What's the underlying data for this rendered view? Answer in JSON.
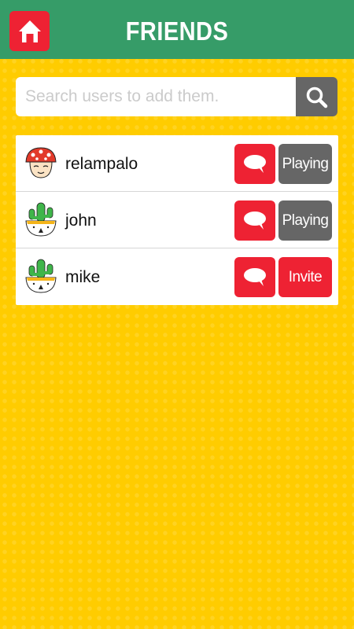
{
  "header": {
    "title": "FRIENDS",
    "home_icon": "home-icon",
    "background_color": "#369c68"
  },
  "search": {
    "placeholder": "Search users to add them.",
    "value": "",
    "button_icon": "search-icon"
  },
  "friends": [
    {
      "name": "relampalo",
      "avatar": "mushroom-avatar",
      "status": "Playing",
      "chat_icon": "chat-bubble-icon"
    },
    {
      "name": "john",
      "avatar": "cactus-avatar",
      "status": "Playing",
      "chat_icon": "chat-bubble-icon"
    },
    {
      "name": "mike",
      "avatar": "cactus-avatar",
      "status": "Invite",
      "chat_icon": "chat-bubble-icon"
    }
  ],
  "colors": {
    "background": "#ffcc00",
    "accent_red": "#ee2233",
    "gray": "#666666",
    "green": "#369c68"
  }
}
